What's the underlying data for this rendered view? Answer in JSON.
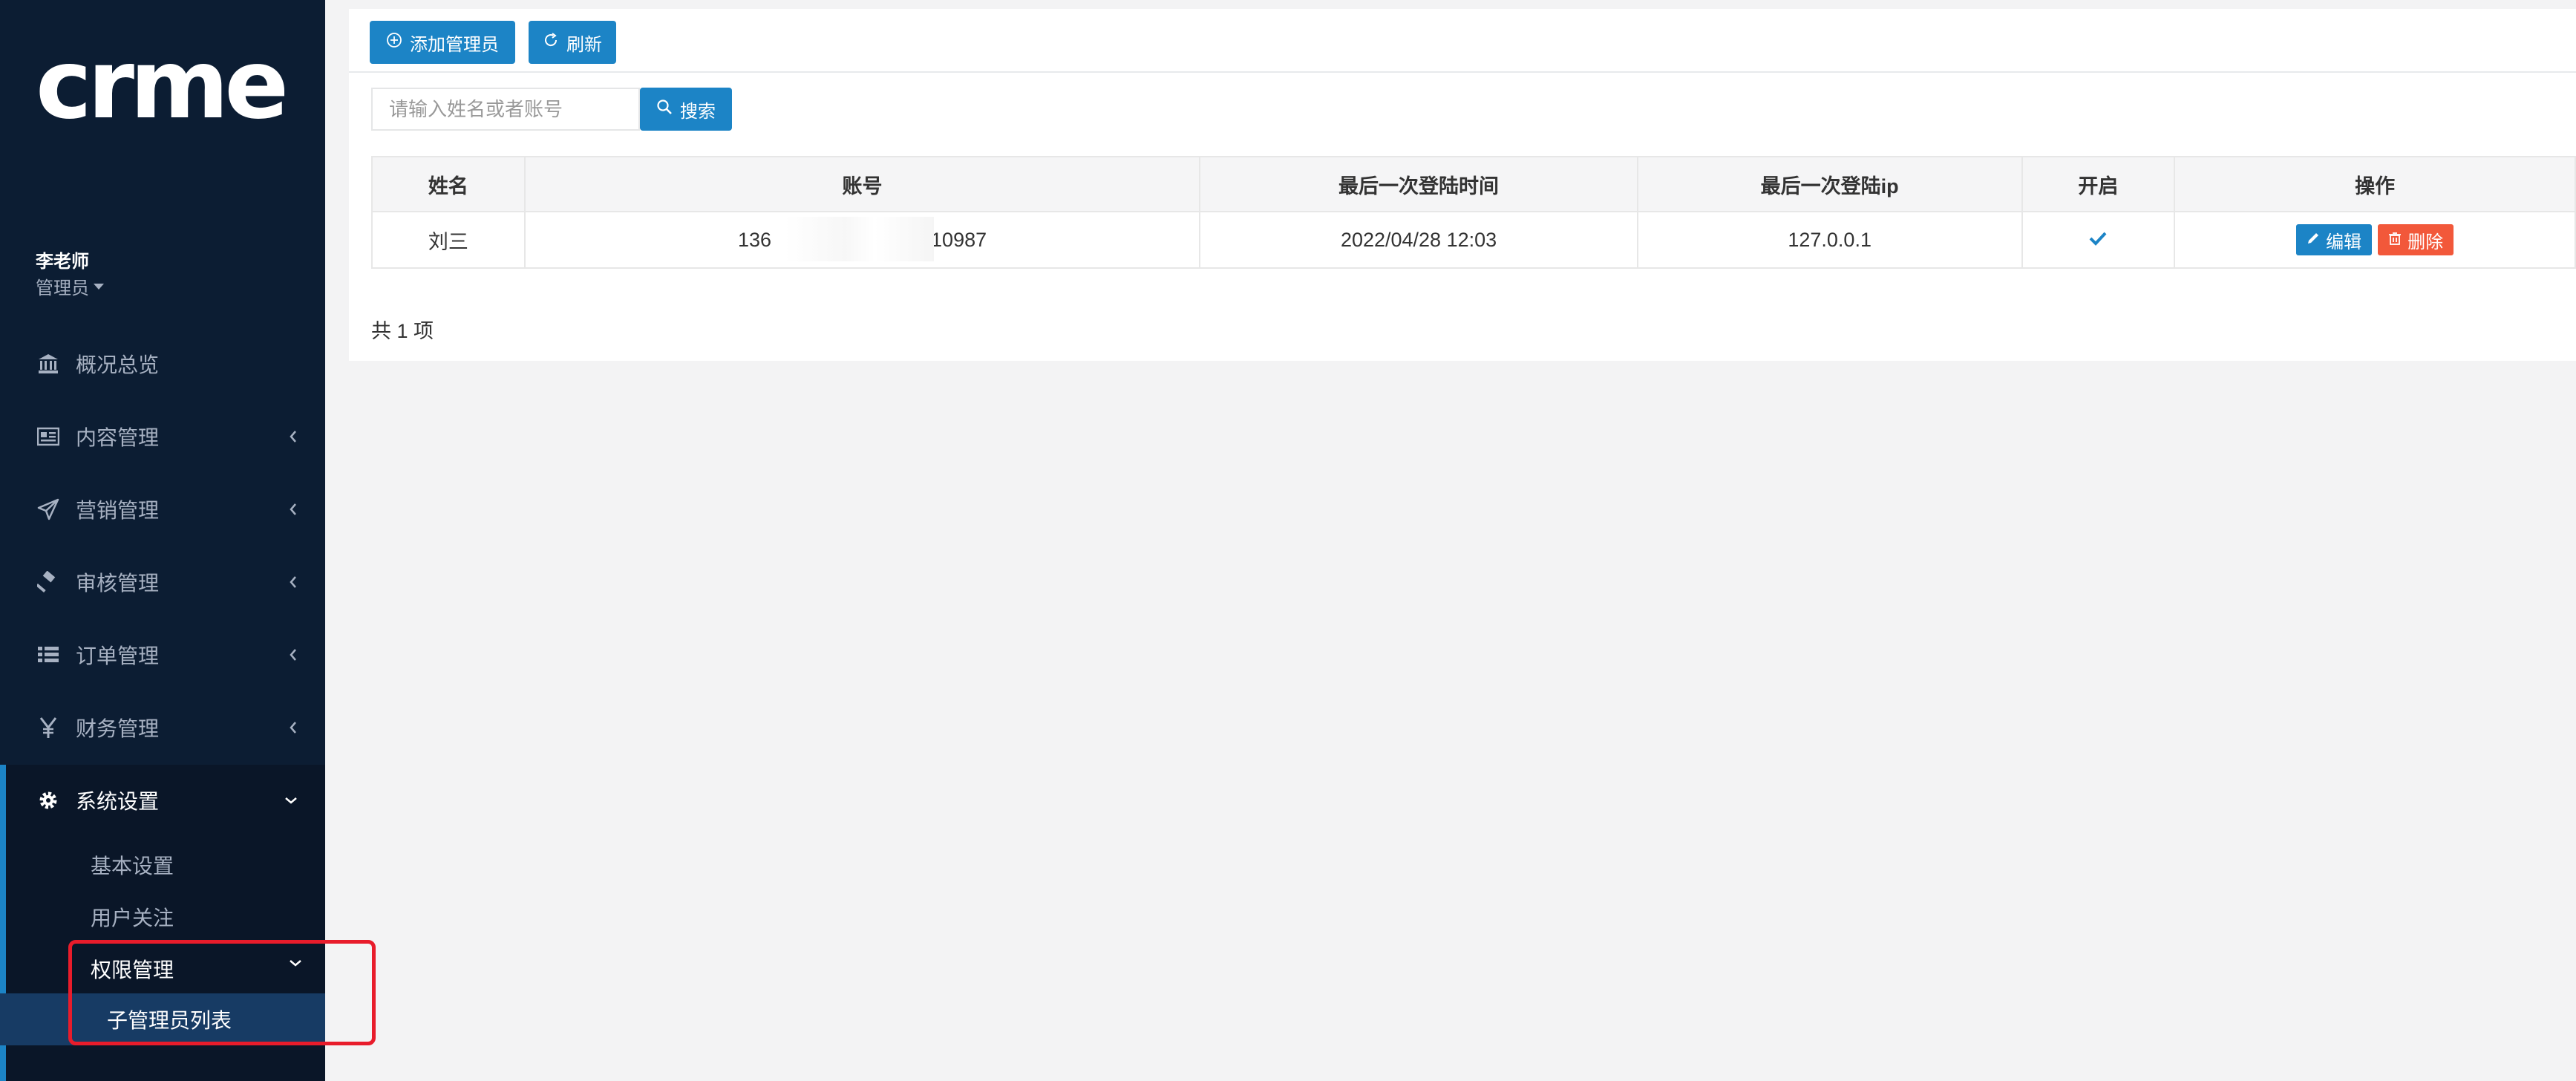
{
  "sidebar": {
    "logo_text": "crmeb",
    "user_name": "李老师",
    "user_role": "管理员",
    "menu": [
      {
        "label": "概况总览",
        "icon": "bank-icon"
      },
      {
        "label": "内容管理",
        "icon": "newspaper-icon"
      },
      {
        "label": "营销管理",
        "icon": "paper-plane-icon"
      },
      {
        "label": "审核管理",
        "icon": "gavel-icon"
      },
      {
        "label": "订单管理",
        "icon": "list-icon"
      },
      {
        "label": "财务管理",
        "icon": "yen-icon"
      }
    ],
    "active_menu": {
      "label": "系统设置",
      "icon": "gear-icon"
    },
    "submenu": [
      "基本设置",
      "用户关注",
      "权限管理"
    ],
    "subsub_active": "子管理员列表"
  },
  "toolbar": {
    "add_label": "添加管理员",
    "refresh_label": "刷新"
  },
  "search": {
    "placeholder": "请输入姓名或者账号",
    "button_label": "搜索"
  },
  "table": {
    "headers": [
      "姓名",
      "账号",
      "最后一次登陆时间",
      "最后一次登陆ip",
      "开启",
      "操作"
    ],
    "rows": [
      {
        "name": "刘三",
        "account_prefix": "136",
        "account_suffix": "210987",
        "last_login": "2022/04/28 12:03",
        "last_ip": "127.0.0.1",
        "enabled": true
      }
    ],
    "edit_label": "编辑",
    "delete_label": "删除"
  },
  "footer": {
    "total_text": "共 1 项"
  },
  "colors": {
    "sidebar_bg": "#0c1d33",
    "primary": "#1c84c6",
    "danger": "#f2583a",
    "highlight_frame": "#e81c2b"
  }
}
